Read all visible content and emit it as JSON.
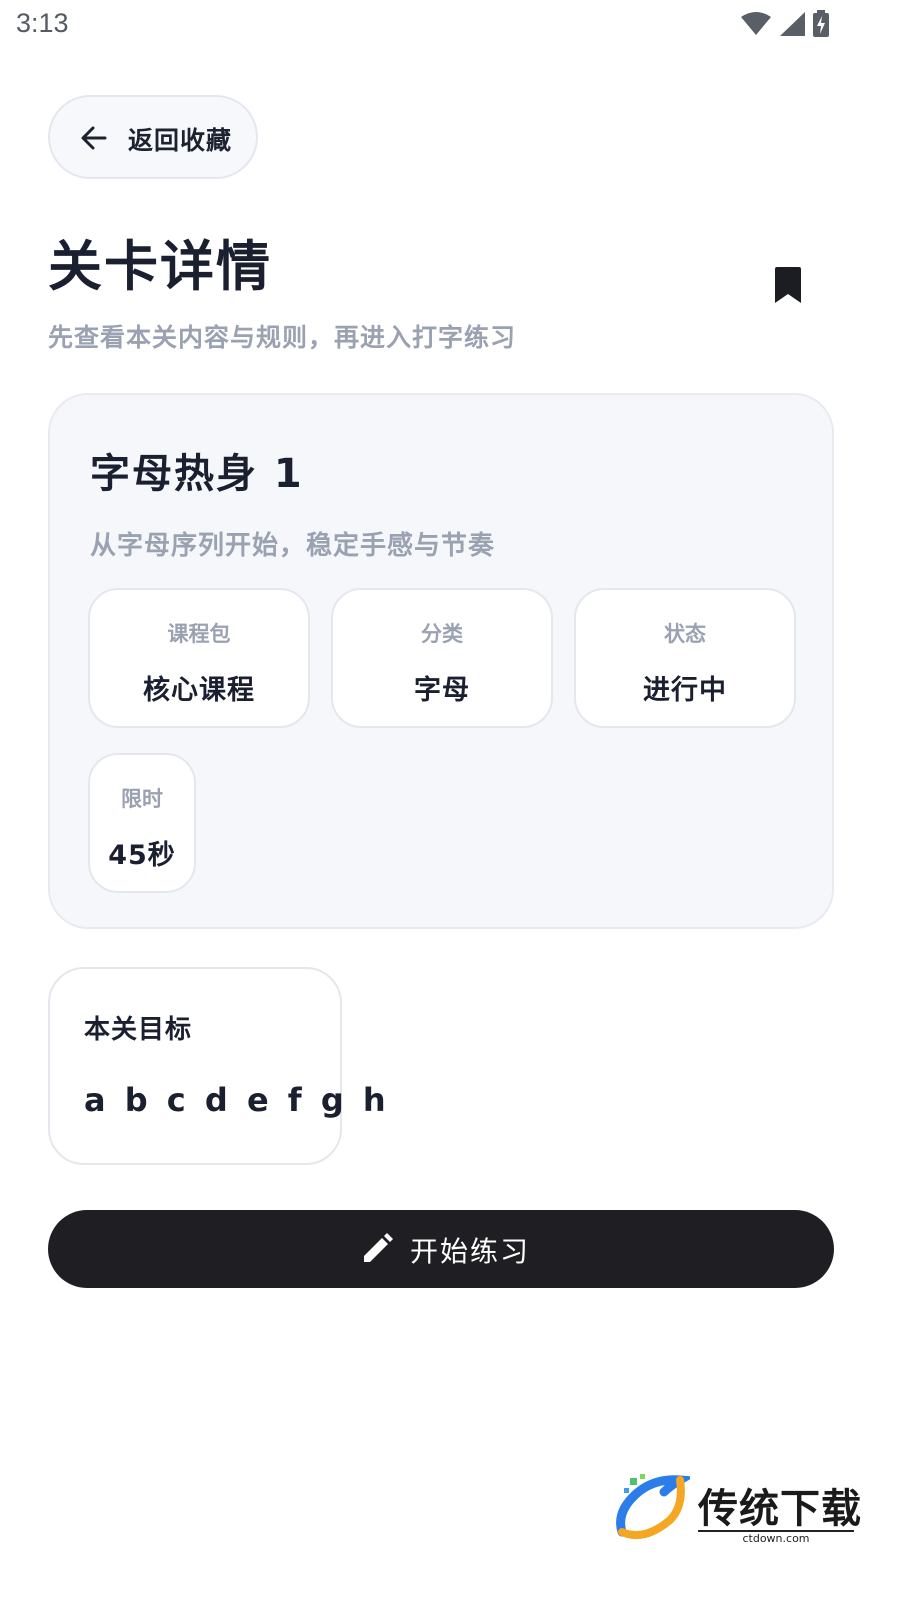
{
  "status_bar": {
    "time": "3:13",
    "icons": [
      "wifi-icon",
      "signal-icon",
      "battery-charging-icon"
    ]
  },
  "header": {
    "back_label": "返回收藏",
    "title": "关卡详情",
    "subtitle": "先查看本关内容与规则，再进入打字练习",
    "bookmark_icon": "bookmark-icon"
  },
  "level": {
    "name": "字母热身 1",
    "description": "从字母序列开始，稳定手感与节奏",
    "info": [
      {
        "label": "课程包",
        "value": "核心课程"
      },
      {
        "label": "分类",
        "value": "字母"
      },
      {
        "label": "状态",
        "value": "进行中"
      },
      {
        "label": "限时",
        "value": "45秒"
      }
    ]
  },
  "goal": {
    "title": "本关目标",
    "text": "a b c d e f g h"
  },
  "actions": {
    "start_label": "开始练习",
    "start_icon": "pencil-icon"
  },
  "watermark": {
    "text": "传统下载",
    "sub": "ctdown.com"
  },
  "colors": {
    "primary_dark": "#1f1f23",
    "muted_text": "#9aa2b1",
    "card_bg": "#f6f7fb"
  }
}
